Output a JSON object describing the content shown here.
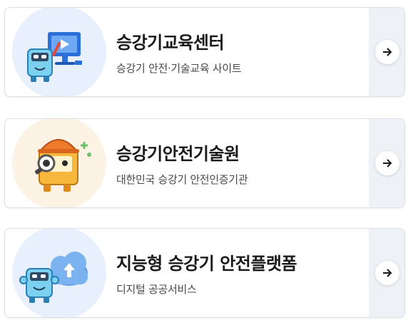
{
  "cards": [
    {
      "title": "승강기교육센터",
      "subtitle": "승강기 안전·기술교육 사이트",
      "icon": "computer-mascot-icon"
    },
    {
      "title": "승강기안전기술원",
      "subtitle": "대한민국 승강기 안전인증기관",
      "icon": "inspector-mascot-icon"
    },
    {
      "title": "지능형 승강기 안전플랫폼",
      "subtitle": "디지털 공공서비스",
      "icon": "cloud-mascot-icon"
    }
  ],
  "colors": {
    "accent": "#2b7de0",
    "side_panel": "#eef2f7"
  }
}
